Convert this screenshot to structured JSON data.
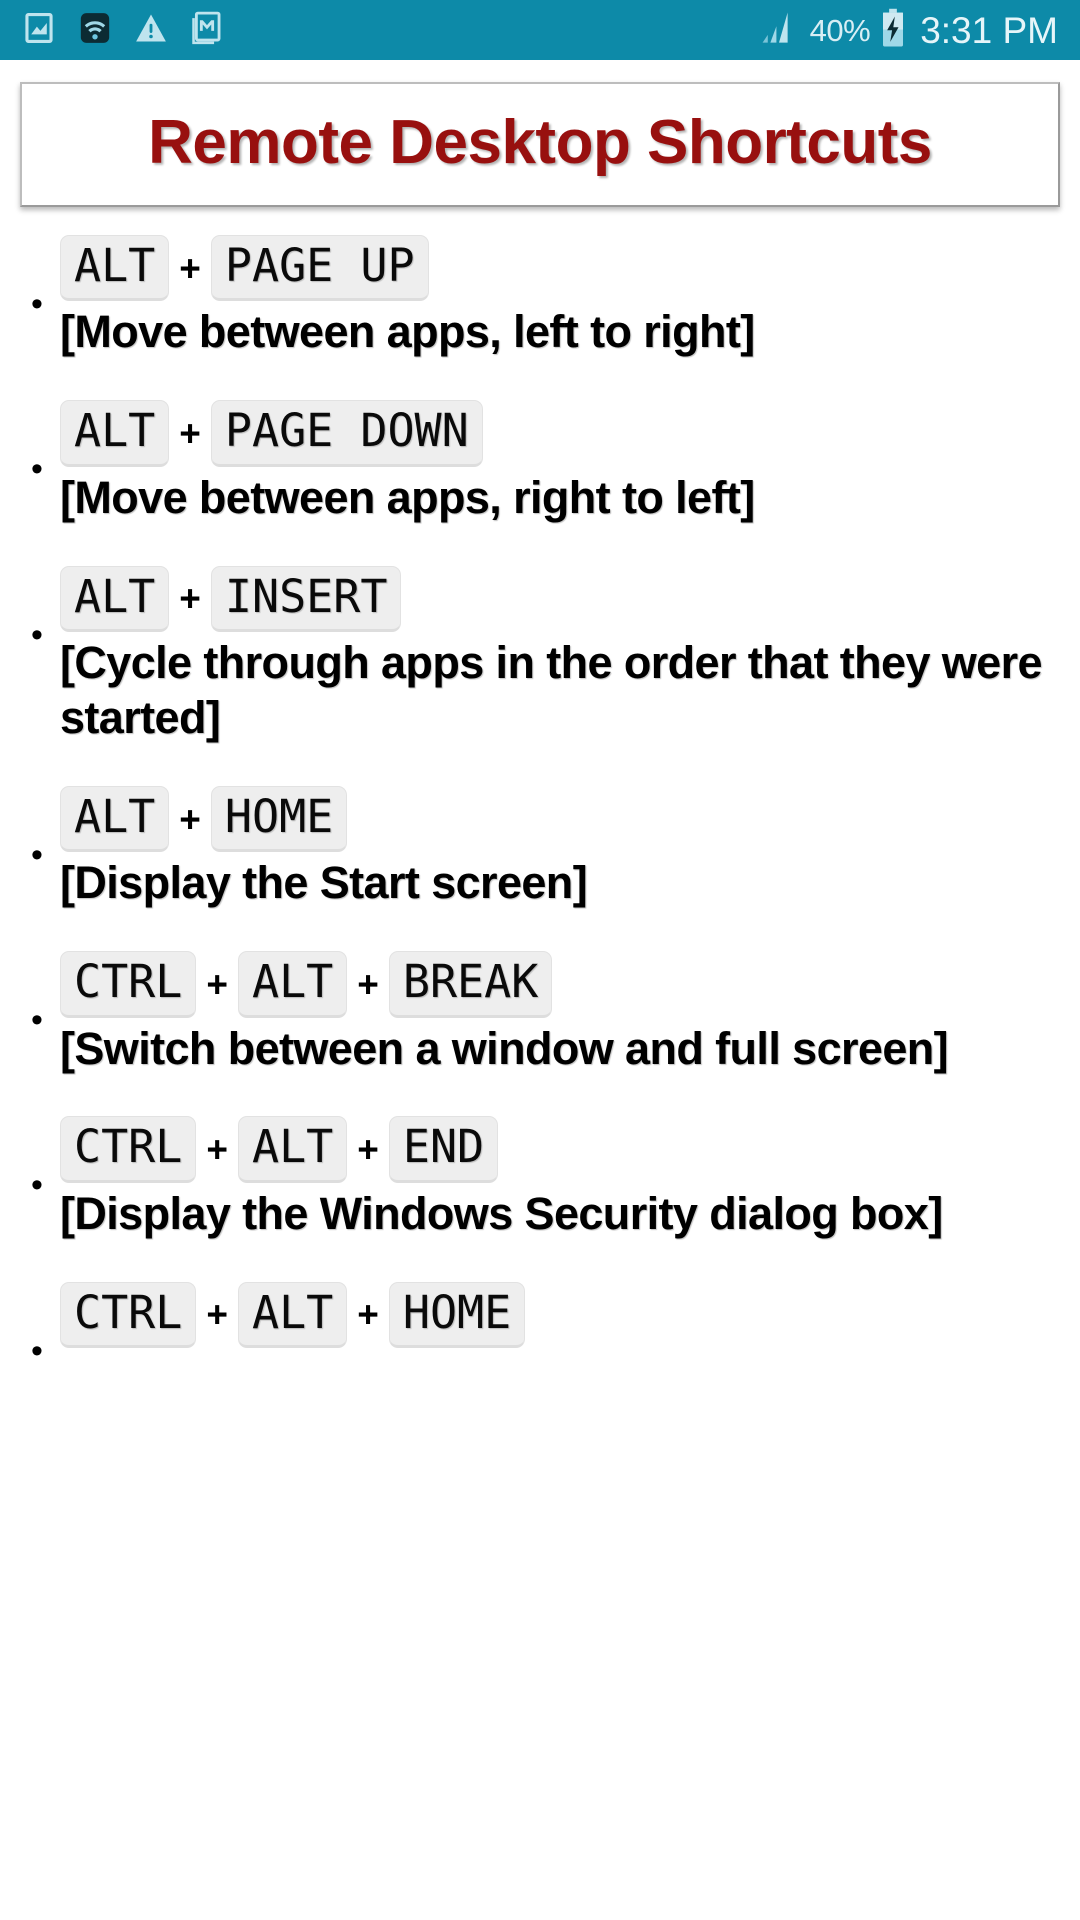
{
  "statusbar": {
    "icons": [
      "image-icon",
      "wifi-icon",
      "warning-icon",
      "gmail-icon"
    ],
    "signal_icon": "signal-bars-icon",
    "battery_percent": "40%",
    "battery_icon": "battery-charging-icon",
    "time": "3:31 PM",
    "background_color": "#0d8aa8",
    "text_color": "#e6f5f9"
  },
  "header": {
    "title": "Remote Desktop Shortcuts",
    "title_color": "#98100f"
  },
  "shortcuts": [
    {
      "keys": [
        "ALT",
        "PAGE UP"
      ],
      "separator": "+",
      "description": "[Move between apps, left to right]"
    },
    {
      "keys": [
        "ALT",
        "PAGE DOWN"
      ],
      "separator": "+",
      "description": "[Move between apps, right to left]"
    },
    {
      "keys": [
        "ALT",
        "INSERT"
      ],
      "separator": "+",
      "description": "[Cycle through apps in the order that they were started]"
    },
    {
      "keys": [
        "ALT",
        "HOME"
      ],
      "separator": "+",
      "description": "[Display the Start screen]"
    },
    {
      "keys": [
        "CTRL",
        "ALT",
        "BREAK"
      ],
      "separator": "+",
      "description": "[Switch between a window and full screen]"
    },
    {
      "keys": [
        "CTRL",
        "ALT",
        "END"
      ],
      "separator": "+",
      "description": "[Display the Windows Security dialog box]"
    },
    {
      "keys": [
        "CTRL",
        "ALT",
        "HOME"
      ],
      "separator": "+",
      "description": ""
    }
  ]
}
